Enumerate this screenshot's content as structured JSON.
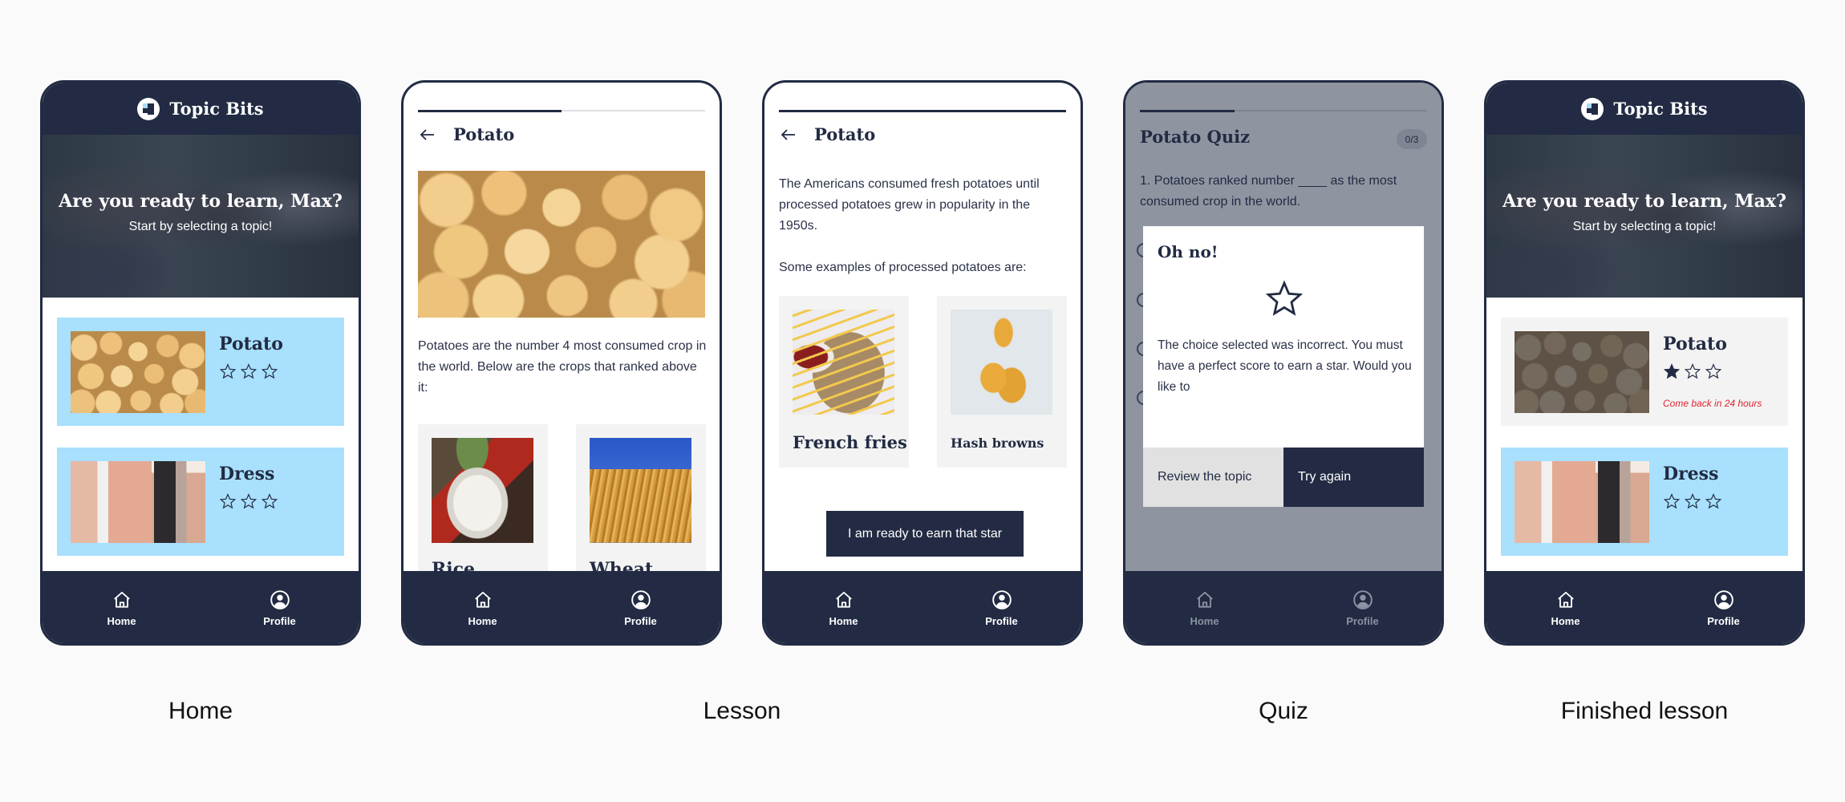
{
  "colors": {
    "navy": "#222b43",
    "card_blue": "#a8e0fd",
    "card_done": "#f3f3f3",
    "alert_red": "#e0242f",
    "overlay_gray": "#8f95a0"
  },
  "nav": {
    "items": [
      {
        "label": "Home",
        "icon": "home-icon"
      },
      {
        "label": "Profile",
        "icon": "profile-icon"
      }
    ]
  },
  "home": {
    "app_title": "Topic Bits",
    "logo_icon": "topic-bits-logo-icon",
    "hero_title": "Are you ready to learn, Max?",
    "hero_subtitle": "Start by selecting a topic!",
    "topics": [
      {
        "name": "Potato",
        "stars_earned": 0,
        "stars_total": 3
      },
      {
        "name": "Dress",
        "stars_earned": 0,
        "stars_total": 3
      }
    ],
    "caption": "Home"
  },
  "lesson_1": {
    "title": "Potato",
    "progress": 0.5,
    "paragraph": "Potatoes are the number 4 most consumed crop in the world. Below are the crops that ranked above it:",
    "cards": [
      {
        "name": "Rice"
      },
      {
        "name": "Wheat"
      }
    ]
  },
  "lesson_2": {
    "title": "Potato",
    "progress": 1.0,
    "paragraph_1": "The Americans consumed fresh potatoes until processed potatoes grew in popularity in the 1950s.",
    "paragraph_2": "Some examples of processed potatoes are:",
    "cards": [
      {
        "name": "French fries"
      },
      {
        "name": "Hash browns"
      }
    ],
    "cta_label": "I am ready to earn that star"
  },
  "lesson_caption": "Lesson",
  "quiz": {
    "title": "Potato Quiz",
    "progress": 0.33,
    "score": "0/3",
    "question": "1. Potatoes ranked number ____ as the most consumed crop in the world.",
    "radio_count": 4,
    "modal": {
      "title": "Oh no!",
      "icon": "star-outline-icon",
      "message": "The choice selected was incorrect. You must have a perfect score to earn a star. Would you like to",
      "secondary_label": "Review the topic",
      "primary_label": "Try again"
    },
    "caption": "Quiz"
  },
  "finished": {
    "app_title": "Topic Bits",
    "hero_title": "Are you ready to learn, Max?",
    "hero_subtitle": "Start by selecting a topic!",
    "topics": [
      {
        "name": "Potato",
        "stars_earned": 1,
        "stars_total": 3,
        "note": "Come back in 24 hours"
      },
      {
        "name": "Dress",
        "stars_earned": 0,
        "stars_total": 3
      }
    ],
    "caption": "Finished lesson"
  }
}
